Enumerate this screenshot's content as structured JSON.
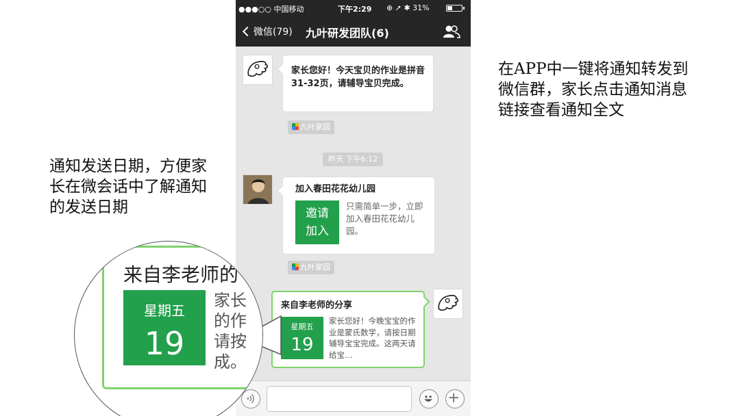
{
  "status_bar": {
    "carrier": "●●●○○ 中国移动",
    "time": "下午2:29",
    "battery": "31%"
  },
  "nav": {
    "back_label": "微信(79)",
    "title": "九叶研发团队(6)"
  },
  "messages": [
    {
      "text": "家长您好！今天宝贝的作业是拼音31-32页，请辅导宝贝完成。",
      "source": "九叶家园"
    },
    {
      "time": "昨天 下午6:12",
      "title": "加入春田花花幼儿园",
      "button": "邀请\n加入",
      "desc": "只需简单一步，立即加入春田花花幼儿园。",
      "source": "九叶家园"
    },
    {
      "title": "来自李老师的分享",
      "weekday": "星期五",
      "day": "19",
      "desc": "家长您好！今晚宝宝的作业是蒙氏数学，请按日期辅导宝宝完成。这两天请给宝…"
    }
  ],
  "annotations": {
    "right": "在APP中一键将通知转发到微信群，家长点击通知消息链接查看通知全文",
    "left": "通知发送日期，方便家长在微会话中了解通知的发送日期"
  },
  "magnifier": {
    "title": "来自李老师的",
    "weekday": "星期五",
    "day": "19",
    "text": "家长\n的作\n请按\n成。"
  },
  "colors": {
    "accent_green": "#22a04b",
    "bubble_border_green": "#7ed36a",
    "nav_bg": "#262626"
  }
}
